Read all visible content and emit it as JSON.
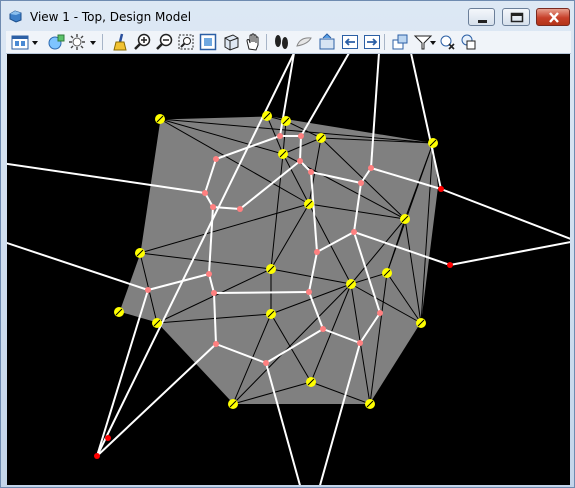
{
  "window": {
    "title": "View 1 - Top, Design Model",
    "controls": [
      "minimize",
      "maximize",
      "close"
    ]
  },
  "toolbar": {
    "tools": [
      {
        "name": "view-attributes-icon",
        "tip": "View Attributes"
      },
      {
        "name": "view-display-mode-icon",
        "tip": "Display Style"
      },
      {
        "name": "view-lighting-icon",
        "tip": "Lighting"
      },
      {
        "name": "update-view-icon",
        "tip": "Update View"
      },
      {
        "name": "zoom-in-icon",
        "tip": "Zoom In"
      },
      {
        "name": "zoom-out-icon",
        "tip": "Zoom Out"
      },
      {
        "name": "window-area-icon",
        "tip": "Window Area"
      },
      {
        "name": "fit-view-icon",
        "tip": "Fit View"
      },
      {
        "name": "rotate-view-icon",
        "tip": "Rotate View"
      },
      {
        "name": "pan-view-icon",
        "tip": "Pan View"
      },
      {
        "name": "walk-icon",
        "tip": "Walk"
      },
      {
        "name": "view-previous-icon",
        "tip": "View Previous"
      },
      {
        "name": "view-next-icon",
        "tip": "View Next"
      },
      {
        "name": "copy-view-icon",
        "tip": "Copy View"
      },
      {
        "name": "clip-volume-icon",
        "tip": "Clip Volume"
      },
      {
        "name": "clip-mask-icon",
        "tip": "Clip Mask"
      },
      {
        "name": "section-icon",
        "tip": "Section"
      }
    ]
  },
  "drawing": {
    "background": "#000000",
    "hull_fill": "#808080",
    "triangulation_color": "#000000",
    "voronoi_color": "#ffffff",
    "site_color": "#ffff00",
    "vertex_color": "#ff8080",
    "outer_vertex_color": "#ff0000"
  }
}
